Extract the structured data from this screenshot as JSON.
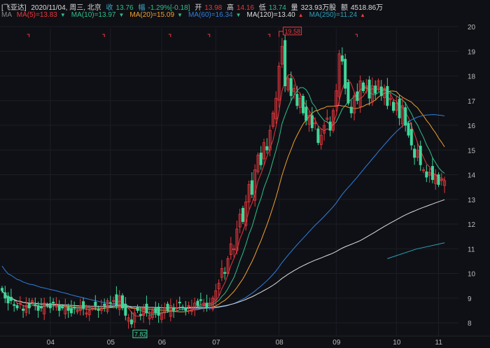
{
  "header": {
    "name": "[飞亚达]",
    "date": "2020/11/04, 周三, 北京",
    "close_label": "收",
    "close": "13.76",
    "chg_label": "幅",
    "chg": "-1.29%[-0.18]",
    "open_label": "开",
    "open": "13.98",
    "high_label": "高",
    "high": "14.16",
    "low_label": "低",
    "low": "13.74",
    "vol_label": "量",
    "vol": "323.93万股",
    "amt_label": "额",
    "amt": "4518.86万"
  },
  "ma_legend": {
    "label": "MA",
    "items": [
      {
        "text": "MA(5)=13.83",
        "color": "#e8383d",
        "dir": "down"
      },
      {
        "text": "MA(10)=13.97",
        "color": "#2fbf8a",
        "dir": "down"
      },
      {
        "text": "MA(20)=15.09",
        "color": "#f0a030",
        "dir": "down"
      },
      {
        "text": "MA(60)=16.34",
        "color": "#2f7fe0",
        "dir": "down"
      },
      {
        "text": "MA(120)=13.40",
        "color": "#dddddd",
        "dir": "up"
      },
      {
        "text": "MA(250)=11.24",
        "color": "#2aa0b8",
        "dir": "up"
      }
    ]
  },
  "chart_data": {
    "type": "candlestick",
    "ylim": [
      7.6,
      20.2
    ],
    "yticks": [
      "8",
      "9",
      "10",
      "11",
      "12",
      "13",
      "14",
      "15",
      "16",
      "17",
      "18",
      "19",
      "20"
    ],
    "xticks": [
      {
        "label": "04",
        "day": 16
      },
      {
        "label": "05",
        "day": 36
      },
      {
        "label": "06",
        "day": 53
      },
      {
        "label": "07",
        "day": 71
      },
      {
        "label": "08",
        "day": 92
      },
      {
        "label": "09",
        "day": 111
      },
      {
        "label": "10",
        "day": 131
      },
      {
        "label": "11",
        "day": 145
      }
    ],
    "closes": [
      9.3,
      9.0,
      8.8,
      8.9,
      8.7,
      8.6,
      8.8,
      8.5,
      8.7,
      8.6,
      8.9,
      8.7,
      8.5,
      8.6,
      8.8,
      8.7,
      8.6,
      8.8,
      8.7,
      8.5,
      8.6,
      8.7,
      8.5,
      8.4,
      8.6,
      8.5,
      8.7,
      8.6,
      8.4,
      8.5,
      8.6,
      8.7,
      8.5,
      8.6,
      8.7,
      8.9,
      8.8,
      8.9,
      8.7,
      9.1,
      8.6,
      8.3,
      8.2,
      7.95,
      8.4,
      8.5,
      8.3,
      8.6,
      8.4,
      8.3,
      8.5,
      8.4,
      8.3,
      8.4,
      8.6,
      8.5,
      8.7,
      8.5,
      8.6,
      8.8,
      8.6,
      8.5,
      8.7,
      8.6,
      8.8,
      8.7,
      8.9,
      8.8,
      8.6,
      8.8,
      9.0,
      9.3,
      9.6,
      10.2,
      10.0,
      10.6,
      11.2,
      11.0,
      11.8,
      12.4,
      12.1,
      12.9,
      13.6,
      13.2,
      14.2,
      14.8,
      14.4,
      15.3,
      15.0,
      15.8,
      16.5,
      17.1,
      18.4,
      19.2,
      17.6,
      17.9,
      17.2,
      17.5,
      16.8,
      17.1,
      16.5,
      16.2,
      16.4,
      15.9,
      16.1,
      15.3,
      15.6,
      16.0,
      16.3,
      15.8,
      16.6,
      17.4,
      18.9,
      18.6,
      17.5,
      16.9,
      16.5,
      17.2,
      17.0,
      17.8,
      17.4,
      17.6,
      17.1,
      17.6,
      17.3,
      17.8,
      17.2,
      17.5,
      16.8,
      17.1,
      16.6,
      16.9,
      16.3,
      16.8,
      16.0,
      15.6,
      15.2,
      14.7,
      15.0,
      14.4,
      14.2,
      13.9,
      14.1,
      13.8,
      14.0,
      13.6,
      13.8,
      13.76
    ],
    "ma250": {
      "start_day": 128,
      "start": 10.6,
      "end": 11.24
    },
    "annotations": {
      "high": "19.58",
      "high_day": 92,
      "low": "7.82",
      "low_day": 43
    },
    "markers_days": [
      9,
      34,
      56,
      69,
      89,
      118
    ]
  }
}
